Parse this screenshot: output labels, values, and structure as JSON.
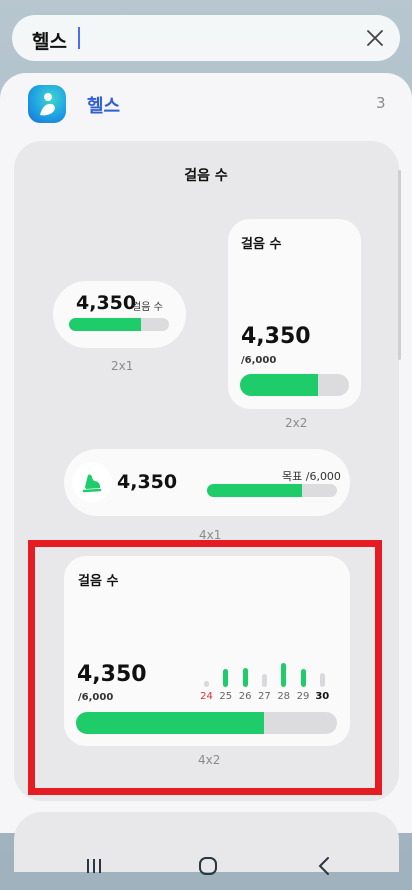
{
  "search": {
    "query": "헬스"
  },
  "app": {
    "name": "헬스",
    "count": "3"
  },
  "section": {
    "title": "걸음 수"
  },
  "widgets": {
    "w2x1": {
      "steps": "4,350",
      "label": "걸음 수",
      "size": "2x1",
      "progress": 0.72
    },
    "w2x2": {
      "title": "걸음 수",
      "steps": "4,350",
      "goal": "/6,000",
      "size": "2x2",
      "progress": 0.72
    },
    "w4x1": {
      "steps": "4,350",
      "goal_label": "목표 /6,000",
      "size": "4x1",
      "progress": 0.73
    },
    "w4x2": {
      "title": "걸음 수",
      "steps": "4,350",
      "goal": "/6,000",
      "size": "4x2",
      "progress": 0.72,
      "days": [
        "24",
        "25",
        "26",
        "27",
        "28",
        "29",
        "30"
      ],
      "day_values": [
        0.15,
        0.55,
        0.6,
        0.4,
        0.75,
        0.55,
        0.45
      ],
      "day_active": [
        false,
        true,
        true,
        false,
        true,
        true,
        false
      ],
      "today_index": 6,
      "sunday_index": 0
    }
  },
  "colors": {
    "accent": "#1fcc6a",
    "highlight": "#e51c22",
    "app_name": "#2f5fd0"
  }
}
